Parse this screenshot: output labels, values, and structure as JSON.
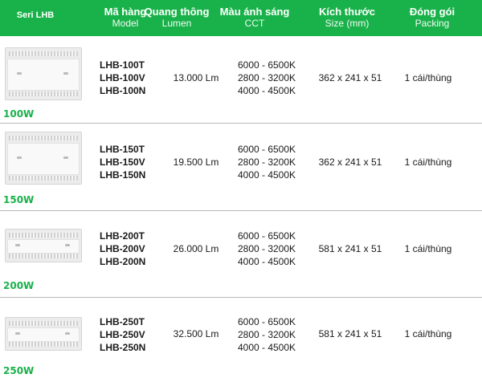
{
  "header": {
    "series": "Seri LHB",
    "model_vi": "Mã hàng",
    "model_en": "Model",
    "lumen_vi": "Quang thông",
    "lumen_en": "Lumen",
    "cct_vi": "Màu ánh sáng",
    "cct_en": "CCT",
    "size_vi": "Kích thước",
    "size_en": "Size (mm)",
    "pack_vi": "Đóng gói",
    "pack_en": "Packing"
  },
  "rows": [
    {
      "watt": "100W",
      "models": [
        "LHB-100T",
        "LHB-100V",
        "LHB-100N"
      ],
      "lumen": "13.000 Lm",
      "cct": [
        "6000 - 6500K",
        "2800 - 3200K",
        "4000 - 4500K"
      ],
      "size": "362 x 241 x 51",
      "packing": "1 cái/thùng"
    },
    {
      "watt": "150W",
      "models": [
        "LHB-150T",
        "LHB-150V",
        "LHB-150N"
      ],
      "lumen": "19.500 Lm",
      "cct": [
        "6000 - 6500K",
        "2800 - 3200K",
        "4000 - 4500K"
      ],
      "size": "362 x 241 x 51",
      "packing": "1 cái/thùng"
    },
    {
      "watt": "200W",
      "models": [
        "LHB-200T",
        "LHB-200V",
        "LHB-200N"
      ],
      "lumen": "26.000 Lm",
      "cct": [
        "6000 - 6500K",
        "2800 - 3200K",
        "4000 - 4500K"
      ],
      "size": "581 x 241 x 51",
      "packing": "1 cái/thùng"
    },
    {
      "watt": "250W",
      "models": [
        "LHB-250T",
        "LHB-250V",
        "LHB-250N"
      ],
      "lumen": "32.500 Lm",
      "cct": [
        "6000 - 6500K",
        "2800 - 3200K",
        "4000 - 4500K"
      ],
      "size": "581 x 241 x 51",
      "packing": "1 cái/thùng"
    }
  ],
  "colors": {
    "header_bg": "#19b24a",
    "watt_text": "#19b24a",
    "divider": "#b7b7b7"
  },
  "icons": {
    "product_image": "highbay-lamp-icon"
  }
}
